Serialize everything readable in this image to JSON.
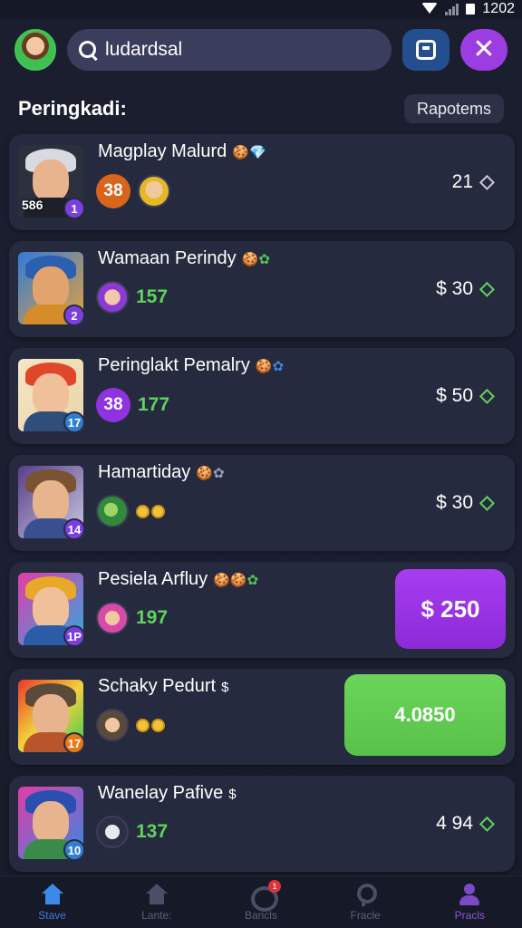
{
  "status_bar": {
    "time": "1202"
  },
  "header": {
    "search_value": "ludardsal"
  },
  "section": {
    "title": "Peringkadi:",
    "report_label": "Rapotems"
  },
  "rows": [
    {
      "name": "Magplay Malurd",
      "emoji": "🍪💎",
      "level": "586",
      "rank": "1",
      "badge": "38",
      "badge_color": "#d9641c",
      "value": "21",
      "value_style": "plain"
    },
    {
      "name": "Wamaan Perindy",
      "emoji": "🍪✿",
      "rank": "2",
      "score": "157",
      "value": "$ 30",
      "value_style": "plain"
    },
    {
      "name": "Peringlakt Pemalry",
      "emoji": "🍪✿",
      "rank": "17",
      "badge": "38",
      "badge_color": "#8f32e0",
      "score": "177",
      "value": "$ 50",
      "value_style": "plain"
    },
    {
      "name": "Hamartiday",
      "emoji": "🍪✿",
      "rank": "14",
      "value": "$ 30",
      "value_style": "plain"
    },
    {
      "name": "Pesiela Arfluy",
      "emoji": "🍪🍪✿",
      "rank": "1P",
      "score": "197",
      "value": "$ 250",
      "value_style": "purple"
    },
    {
      "name": "Schaky Pedurt",
      "emoji": "$",
      "rank": "17",
      "value": "4.0850",
      "value_style": "green"
    },
    {
      "name": "Wanelay Pafive",
      "emoji": "$",
      "rank": "10",
      "score": "137",
      "value": "4 94",
      "value_style": "plain"
    }
  ],
  "nav": [
    {
      "label": "Stave",
      "icon": "home-icon"
    },
    {
      "label": "Lante:",
      "icon": "home-icon"
    },
    {
      "label": "Bancls",
      "icon": "gift-icon",
      "badge": "1"
    },
    {
      "label": "Fracle",
      "icon": "find-icon"
    },
    {
      "label": "Pracls",
      "icon": "person-icon"
    }
  ],
  "colors": {
    "accent_purple": "#9b3de0",
    "accent_green": "#5fd35b",
    "accent_blue": "#3c7bd8",
    "card_bg": "#262a3e"
  }
}
